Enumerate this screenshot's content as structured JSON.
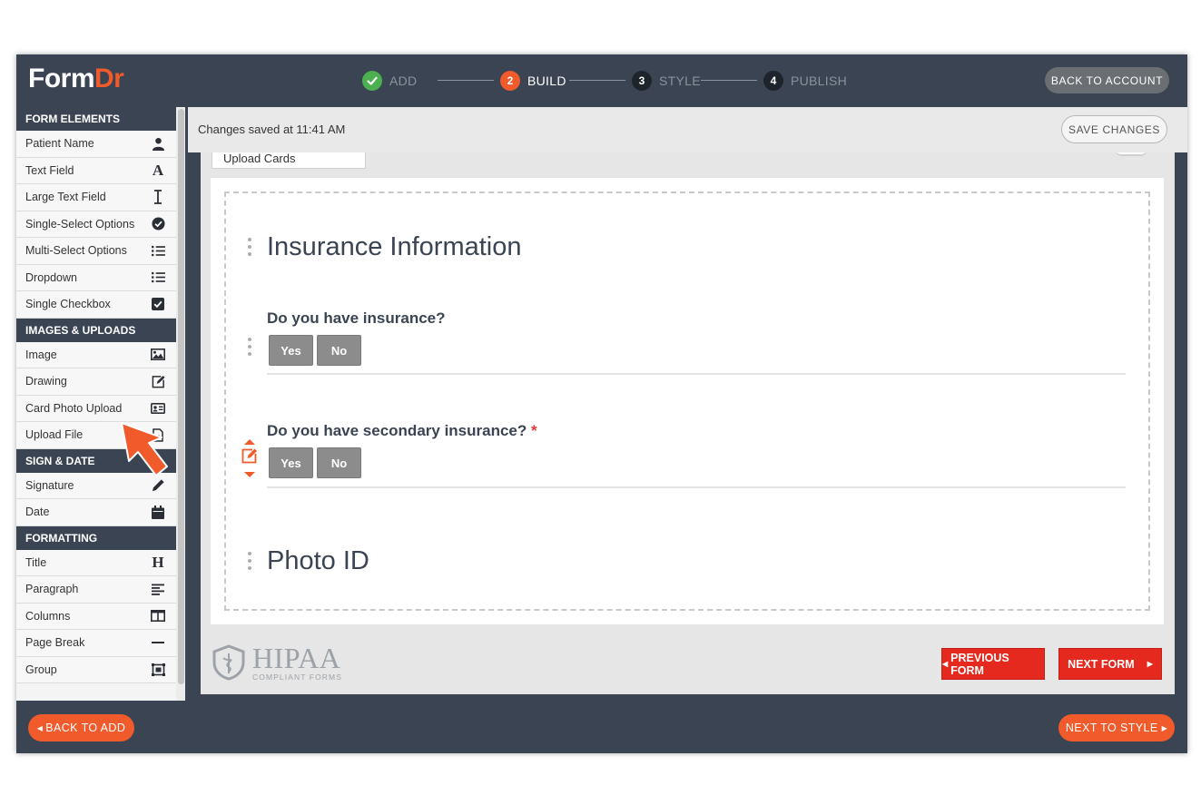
{
  "app": {
    "logo_main": "Form",
    "logo_accent": "Dr",
    "back_to_account": "BACK TO ACCOUNT",
    "accent_color": "#f15a2b"
  },
  "steps": [
    {
      "num": "",
      "label": "ADD",
      "state": "done"
    },
    {
      "num": "2",
      "label": "BUILD",
      "state": "active"
    },
    {
      "num": "3",
      "label": "STYLE",
      "state": "todo"
    },
    {
      "num": "4",
      "label": "PUBLISH",
      "state": "todo"
    }
  ],
  "sidebar": {
    "form_elements": {
      "heading": "FORM ELEMENTS",
      "items": [
        {
          "label": "Patient Name",
          "icon": "person-icon"
        },
        {
          "label": "Text Field",
          "icon": "letter-a-icon"
        },
        {
          "label": "Large Text Field",
          "icon": "text-cursor-icon"
        },
        {
          "label": "Single-Select Options",
          "icon": "check-circle-icon"
        },
        {
          "label": "Multi-Select Options",
          "icon": "list-icon"
        },
        {
          "label": "Dropdown",
          "icon": "list-icon"
        },
        {
          "label": "Single Checkbox",
          "icon": "checkbox-icon"
        }
      ]
    },
    "images_uploads": {
      "heading": "IMAGES & UPLOADS",
      "items": [
        {
          "label": "Image",
          "icon": "image-icon"
        },
        {
          "label": "Drawing",
          "icon": "edit-icon"
        },
        {
          "label": "Card Photo Upload",
          "icon": "id-card-icon"
        },
        {
          "label": "Upload File",
          "icon": "file-icon"
        }
      ]
    },
    "sign_date": {
      "heading": "SIGN & DATE",
      "items": [
        {
          "label": "Signature",
          "icon": "pen-icon"
        },
        {
          "label": "Date",
          "icon": "calendar-icon"
        }
      ]
    },
    "formatting": {
      "heading": "FORMATTING",
      "items": [
        {
          "label": "Title",
          "icon": "heading-icon"
        },
        {
          "label": "Paragraph",
          "icon": "paragraph-icon"
        },
        {
          "label": "Columns",
          "icon": "columns-icon"
        },
        {
          "label": "Page Break",
          "icon": "minus-icon"
        },
        {
          "label": "Group",
          "icon": "group-icon"
        }
      ]
    }
  },
  "main": {
    "saved_text": "Changes saved at 11:41 AM",
    "save_changes": "SAVE CHANGES",
    "upload_cards": "Upload Cards",
    "section1_title": "Insurance Information",
    "q1_label": "Do you have insurance?",
    "q2_label": "Do you have secondary insurance?",
    "q2_required": "*",
    "yes_label": "Yes",
    "no_label": "No",
    "section2_title": "Photo ID",
    "hipaa_big": "HIPAA",
    "hipaa_small": "COMPLIANT FORMS",
    "previous_form": "PREVIOUS FORM",
    "next_form": "NEXT FORM"
  },
  "footer": {
    "back_to_add": "BACK TO ADD",
    "next_to_style": "NEXT TO STYLE"
  }
}
